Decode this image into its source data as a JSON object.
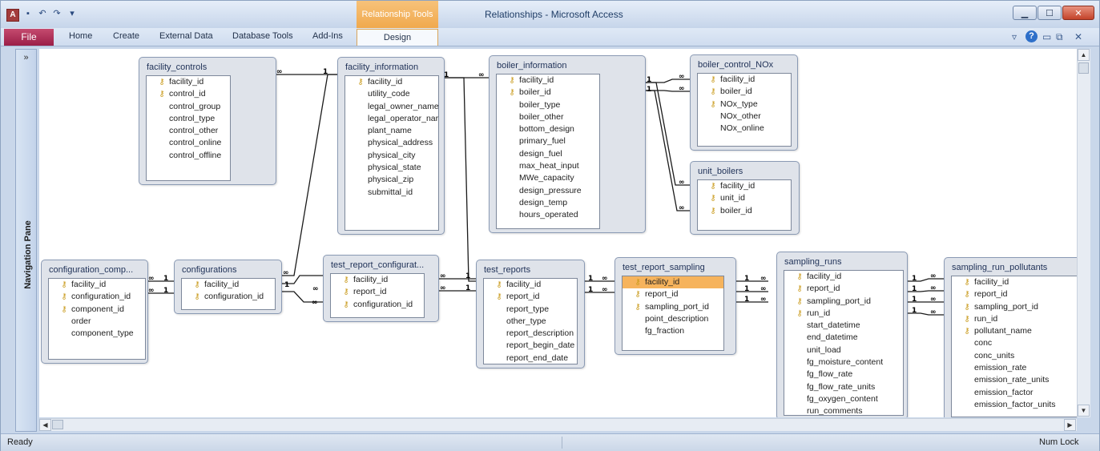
{
  "window": {
    "title": "Relationships - Microsoft Access",
    "contextual_tab_group": "Relationship Tools",
    "app_icon_letter": "A"
  },
  "ribbon": {
    "file_tab": "File",
    "tabs": [
      "Home",
      "Create",
      "External Data",
      "Database Tools",
      "Add-Ins"
    ],
    "active_tab": "Design"
  },
  "nav_pane": {
    "label": "Navigation Pane",
    "toggle": "»"
  },
  "status": {
    "left": "Ready",
    "right": "Num Lock"
  },
  "relationship_labels": {
    "one": "1",
    "many": "∞"
  },
  "colors": {
    "selected_field": "#f6b35c",
    "key_icon": "#c99a1a",
    "file_tab": "#a52a52",
    "contextual": "#f0a94d"
  },
  "tables": [
    {
      "id": "facility_controls",
      "title": "facility_controls",
      "fields": [
        {
          "name": "facility_id",
          "key": true
        },
        {
          "name": "control_id",
          "key": true
        },
        {
          "name": "control_group"
        },
        {
          "name": "control_type"
        },
        {
          "name": "control_other"
        },
        {
          "name": "control_online"
        },
        {
          "name": "control_offline"
        }
      ]
    },
    {
      "id": "facility_information",
      "title": "facility_information",
      "fields": [
        {
          "name": "facility_id",
          "key": true
        },
        {
          "name": "utility_code"
        },
        {
          "name": "legal_owner_name"
        },
        {
          "name": "legal_operator_nar"
        },
        {
          "name": "plant_name"
        },
        {
          "name": "physical_address"
        },
        {
          "name": "physical_city"
        },
        {
          "name": "physical_state"
        },
        {
          "name": "physical_zip"
        },
        {
          "name": "submittal_id"
        }
      ]
    },
    {
      "id": "boiler_information",
      "title": "boiler_information",
      "fields": [
        {
          "name": "facility_id",
          "key": true
        },
        {
          "name": "boiler_id",
          "key": true
        },
        {
          "name": "boiler_type"
        },
        {
          "name": "boiler_other"
        },
        {
          "name": "bottom_design"
        },
        {
          "name": "primary_fuel"
        },
        {
          "name": "design_fuel"
        },
        {
          "name": "max_heat_input"
        },
        {
          "name": "MWe_capacity"
        },
        {
          "name": "design_pressure"
        },
        {
          "name": "design_temp"
        },
        {
          "name": "hours_operated"
        }
      ]
    },
    {
      "id": "boiler_control_NOx",
      "title": "boiler_control_NOx",
      "fields": [
        {
          "name": "facility_id",
          "key": true
        },
        {
          "name": "boiler_id",
          "key": true
        },
        {
          "name": "NOx_type",
          "key": true
        },
        {
          "name": "NOx_other"
        },
        {
          "name": "NOx_online"
        }
      ]
    },
    {
      "id": "unit_boilers",
      "title": "unit_boilers",
      "fields": [
        {
          "name": "facility_id",
          "key": true
        },
        {
          "name": "unit_id",
          "key": true
        },
        {
          "name": "boiler_id",
          "key": true
        }
      ]
    },
    {
      "id": "configuration_comp",
      "title": "configuration_comp...",
      "fields": [
        {
          "name": "facility_id",
          "key": true
        },
        {
          "name": "configuration_id",
          "key": true
        },
        {
          "name": "component_id",
          "key": true
        },
        {
          "name": "order"
        },
        {
          "name": "component_type"
        }
      ]
    },
    {
      "id": "configurations",
      "title": "configurations",
      "fields": [
        {
          "name": "facility_id",
          "key": true
        },
        {
          "name": "configuration_id",
          "key": true
        }
      ]
    },
    {
      "id": "test_report_configuration",
      "title": "test_report_configurat...",
      "fields": [
        {
          "name": "facility_id",
          "key": true
        },
        {
          "name": "report_id",
          "key": true
        },
        {
          "name": "configuration_id",
          "key": true
        }
      ]
    },
    {
      "id": "test_reports",
      "title": "test_reports",
      "fields": [
        {
          "name": "facility_id",
          "key": true
        },
        {
          "name": "report_id",
          "key": true
        },
        {
          "name": "report_type"
        },
        {
          "name": "other_type"
        },
        {
          "name": "report_description"
        },
        {
          "name": "report_begin_date"
        },
        {
          "name": "report_end_date"
        }
      ]
    },
    {
      "id": "test_report_sampling",
      "title": "test_report_sampling",
      "fields": [
        {
          "name": "facility_id",
          "key": true,
          "selected": true
        },
        {
          "name": "report_id",
          "key": true
        },
        {
          "name": "sampling_port_id",
          "key": true
        },
        {
          "name": "point_description"
        },
        {
          "name": "fg_fraction"
        }
      ]
    },
    {
      "id": "sampling_runs",
      "title": "sampling_runs",
      "fields": [
        {
          "name": "facility_id",
          "key": true
        },
        {
          "name": "report_id",
          "key": true
        },
        {
          "name": "sampling_port_id",
          "key": true
        },
        {
          "name": "run_id",
          "key": true
        },
        {
          "name": "start_datetime"
        },
        {
          "name": "end_datetime"
        },
        {
          "name": "unit_load"
        },
        {
          "name": "fg_moisture_content"
        },
        {
          "name": "fg_flow_rate"
        },
        {
          "name": "fg_flow_rate_units"
        },
        {
          "name": "fg_oxygen_content"
        },
        {
          "name": "run_comments"
        }
      ]
    },
    {
      "id": "sampling_run_pollutants",
      "title": "sampling_run_pollutants",
      "fields": [
        {
          "name": "facility_id",
          "key": true
        },
        {
          "name": "report_id",
          "key": true
        },
        {
          "name": "sampling_port_id",
          "key": true
        },
        {
          "name": "run_id",
          "key": true
        },
        {
          "name": "pollutant_name",
          "key": true
        },
        {
          "name": "conc"
        },
        {
          "name": "conc_units"
        },
        {
          "name": "emission_rate"
        },
        {
          "name": "emission_rate_units"
        },
        {
          "name": "emission_factor"
        },
        {
          "name": "emission_factor_units"
        }
      ]
    }
  ]
}
